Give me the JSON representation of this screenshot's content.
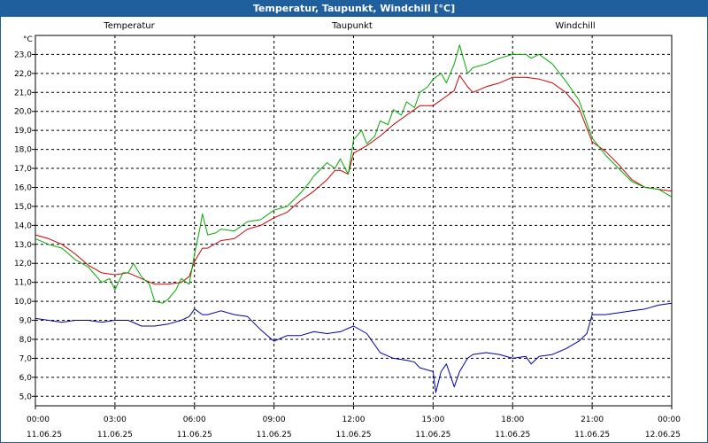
{
  "window": {
    "title": "Temperatur, Taupunkt, Windchill [°C]"
  },
  "chart_data": {
    "type": "line",
    "title": "Temperatur, Taupunkt, Windchill [°C]",
    "ylabel": "°C",
    "ylim": [
      4.5,
      24.0
    ],
    "xlim": [
      0,
      24
    ],
    "grid": true,
    "legend": "top",
    "yticks": [
      "5,0",
      "6,0",
      "7,0",
      "8,0",
      "9,0",
      "10,0",
      "11,0",
      "12,0",
      "13,0",
      "14,0",
      "15,0",
      "16,0",
      "17,0",
      "18,0",
      "19,0",
      "20,0",
      "21,0",
      "22,0",
      "23,0"
    ],
    "xticks": [
      {
        "time": "00:00",
        "date": "11.06.25"
      },
      {
        "time": "03:00",
        "date": "11.06.25"
      },
      {
        "time": "06:00",
        "date": "11.06.25"
      },
      {
        "time": "09:00",
        "date": "11.06.25"
      },
      {
        "time": "12:00",
        "date": "11.06.25"
      },
      {
        "time": "15:00",
        "date": "11.06.25"
      },
      {
        "time": "18:00",
        "date": "11.06.25"
      },
      {
        "time": "21:00",
        "date": "11.06.25"
      },
      {
        "time": "00:00",
        "date": "12.06.25"
      }
    ],
    "series": [
      {
        "name": "Temperatur",
        "color": "#cc0000",
        "x": [
          0,
          0.5,
          1,
          1.5,
          2,
          2.5,
          3,
          3.5,
          4,
          4.5,
          5,
          5.5,
          5.8,
          6,
          6.3,
          6.5,
          7,
          7.5,
          8,
          8.5,
          9,
          9.5,
          10,
          10.5,
          11,
          11.3,
          11.5,
          11.8,
          12,
          12.5,
          13,
          13.5,
          14,
          14.5,
          15,
          15.5,
          15.8,
          16,
          16.3,
          16.5,
          17,
          17.5,
          18,
          18.5,
          19,
          19.5,
          20,
          20.5,
          21,
          21.5,
          22,
          22.5,
          23,
          23.5,
          24
        ],
        "y": [
          13.5,
          13.3,
          13.0,
          12.5,
          11.9,
          11.5,
          11.4,
          11.5,
          11.2,
          10.9,
          10.9,
          11.0,
          11.3,
          12.1,
          12.8,
          12.8,
          13.2,
          13.3,
          13.8,
          14.0,
          14.4,
          14.7,
          15.3,
          15.8,
          16.4,
          16.9,
          16.9,
          16.7,
          17.8,
          18.2,
          18.7,
          19.3,
          19.8,
          20.3,
          20.3,
          20.8,
          21.1,
          21.9,
          21.3,
          21.0,
          21.3,
          21.5,
          21.8,
          21.8,
          21.7,
          21.5,
          21.0,
          20.2,
          18.4,
          17.9,
          17.2,
          16.4,
          16.0,
          15.9,
          15.8
        ]
      },
      {
        "name": "Taupunkt",
        "color": "#0000aa",
        "x": [
          0,
          0.5,
          1,
          1.5,
          2,
          2.5,
          3,
          3.5,
          4,
          4.5,
          5,
          5.5,
          5.8,
          6,
          6.3,
          6.5,
          7,
          7.5,
          8,
          8.5,
          9,
          9.5,
          10,
          10.5,
          11,
          11.5,
          12,
          12.5,
          13,
          13.5,
          14,
          14.3,
          14.5,
          15,
          15.1,
          15.3,
          15.5,
          15.8,
          16,
          16.3,
          16.5,
          17,
          17.5,
          18,
          18.5,
          18.7,
          19,
          19.5,
          20,
          20.5,
          20.8,
          21,
          21.5,
          22,
          22.5,
          23,
          23.5,
          24
        ],
        "y": [
          9.1,
          9.0,
          8.9,
          9.0,
          9.0,
          8.9,
          9.0,
          9.0,
          8.7,
          8.7,
          8.8,
          9.0,
          9.2,
          9.6,
          9.3,
          9.3,
          9.5,
          9.3,
          9.2,
          8.5,
          7.9,
          8.2,
          8.2,
          8.4,
          8.3,
          8.4,
          8.7,
          8.3,
          7.3,
          7.0,
          6.9,
          6.8,
          6.5,
          6.3,
          5.2,
          6.3,
          6.7,
          5.5,
          6.3,
          7.0,
          7.2,
          7.3,
          7.2,
          7.0,
          7.1,
          6.7,
          7.1,
          7.2,
          7.5,
          7.9,
          8.3,
          9.3,
          9.3,
          9.4,
          9.5,
          9.6,
          9.8,
          9.9
        ]
      },
      {
        "name": "Windchill",
        "color": "#00aa00",
        "x": [
          0,
          0.5,
          1,
          1.5,
          2,
          2.5,
          2.8,
          3,
          3.3,
          3.5,
          3.7,
          4,
          4.3,
          4.5,
          4.8,
          5,
          5.3,
          5.5,
          5.8,
          6,
          6.2,
          6.3,
          6.5,
          6.8,
          7,
          7.5,
          8,
          8.5,
          9,
          9.5,
          10,
          10.3,
          10.5,
          11,
          11.3,
          11.5,
          11.8,
          12,
          12.3,
          12.5,
          12.8,
          13,
          13.3,
          13.5,
          13.8,
          14,
          14.3,
          14.5,
          14.8,
          15,
          15.3,
          15.5,
          15.8,
          16,
          16.3,
          16.5,
          17,
          17.5,
          18,
          18.5,
          18.7,
          19,
          19.5,
          20,
          20.5,
          21,
          21.5,
          22,
          22.5,
          23,
          23.5,
          24
        ],
        "y": [
          13.3,
          13.0,
          12.8,
          12.2,
          11.8,
          11.0,
          11.2,
          10.6,
          11.5,
          11.5,
          12.0,
          11.3,
          10.9,
          10.0,
          9.9,
          10.1,
          10.6,
          11.2,
          10.9,
          12.5,
          13.8,
          14.6,
          13.5,
          13.6,
          13.8,
          13.7,
          14.2,
          14.3,
          14.8,
          15.0,
          15.7,
          16.2,
          16.6,
          17.3,
          17.0,
          17.5,
          16.7,
          18.5,
          19.0,
          18.3,
          18.7,
          19.5,
          19.3,
          20.1,
          19.8,
          20.5,
          20.2,
          21.0,
          21.3,
          21.7,
          22.0,
          21.5,
          22.5,
          23.5,
          22.0,
          22.3,
          22.5,
          22.8,
          23.0,
          23.0,
          22.8,
          23.0,
          22.5,
          21.6,
          20.6,
          18.6,
          17.7,
          17.0,
          16.3,
          16.0,
          15.9,
          15.5
        ]
      }
    ]
  }
}
